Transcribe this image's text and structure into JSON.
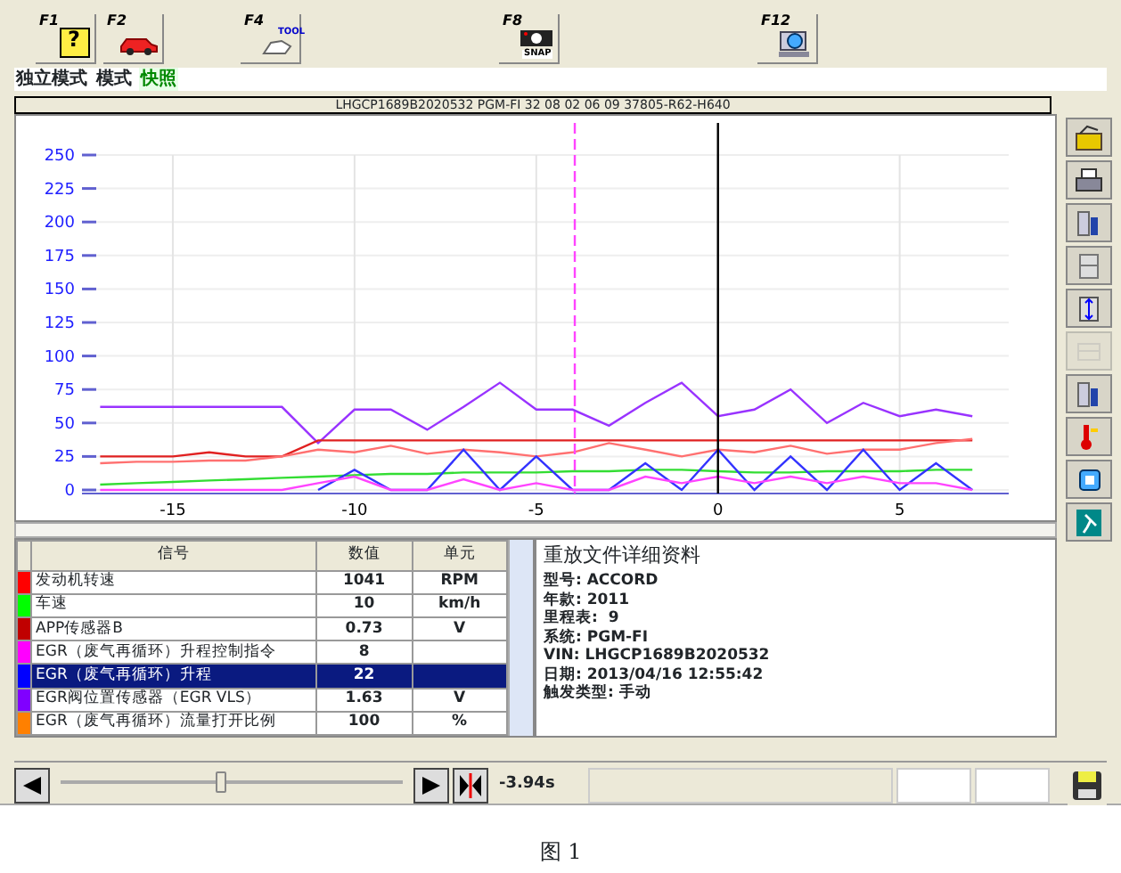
{
  "function_keys": [
    {
      "key": "F1",
      "icon_text": "?"
    },
    {
      "key": "F2"
    },
    {
      "key": "F4",
      "icon_text": "TOOL"
    },
    {
      "key": "F8",
      "icon_text": "SNAP"
    },
    {
      "key": "F12"
    }
  ],
  "mode_bar": [
    {
      "label": "独立模式",
      "selected": false
    },
    {
      "label": "模式",
      "selected": false
    },
    {
      "label": "快照",
      "selected": true
    }
  ],
  "chart_header": "LHGCP1689B2020532  PGM-FI  32 08 02 06 09  37805-R62-H640",
  "chart_data": {
    "type": "line",
    "x": [
      -17,
      -16,
      -15,
      -14,
      -13,
      -12,
      -11,
      -10,
      -9,
      -8,
      -7,
      -6,
      -5,
      -4,
      -3,
      -2,
      -1,
      0,
      1,
      2,
      3,
      4,
      5,
      6,
      7
    ],
    "series": [
      {
        "color": "#9933ff",
        "values": [
          62,
          62,
          62,
          62,
          62,
          62,
          35,
          60,
          60,
          45,
          62,
          80,
          60,
          60,
          48,
          65,
          80,
          55,
          60,
          75,
          50,
          65,
          55,
          60,
          55
        ]
      },
      {
        "color": "#e02020",
        "values": [
          25,
          25,
          25,
          28,
          25,
          25,
          37,
          37,
          37,
          37,
          37,
          37,
          37,
          37,
          37,
          37,
          37,
          37,
          37,
          37,
          37,
          37,
          37,
          37,
          37
        ]
      },
      {
        "color": "#ff7070",
        "values": [
          20,
          21,
          21,
          22,
          22,
          25,
          30,
          28,
          33,
          27,
          30,
          28,
          25,
          28,
          35,
          30,
          25,
          30,
          28,
          33,
          27,
          30,
          30,
          35,
          38
        ]
      },
      {
        "color": "#33dd33",
        "values": [
          4,
          5,
          6,
          7,
          8,
          9,
          10,
          11,
          12,
          12,
          13,
          13,
          13,
          14,
          14,
          15,
          15,
          14,
          13,
          13,
          14,
          14,
          14,
          15,
          15
        ]
      },
      {
        "color": "#3333ff",
        "values": [
          null,
          null,
          null,
          null,
          null,
          null,
          0,
          15,
          0,
          0,
          30,
          0,
          25,
          0,
          0,
          20,
          0,
          30,
          0,
          25,
          0,
          30,
          0,
          20,
          0
        ]
      },
      {
        "color": "#ff44ff",
        "values": [
          0,
          0,
          0,
          0,
          0,
          0,
          5,
          10,
          0,
          0,
          8,
          0,
          5,
          0,
          0,
          10,
          5,
          10,
          5,
          10,
          5,
          10,
          5,
          5,
          0
        ]
      }
    ],
    "xlim": [
      -17.5,
      8
    ],
    "ylim": [
      0,
      250
    ],
    "xticks": [
      -15,
      -10,
      -5,
      0,
      5
    ],
    "yticks": [
      0,
      25,
      50,
      75,
      100,
      125,
      150,
      175,
      200,
      225,
      250
    ],
    "grid": true,
    "ref_lines": [
      {
        "axis": "x",
        "value": -3.94
      },
      {
        "axis": "x",
        "value": 0
      }
    ]
  },
  "table": {
    "columns": [
      "信号",
      "数值",
      "单元"
    ],
    "rows": [
      {
        "color": "#ff0000",
        "signal": "发动机转速",
        "value": "1041",
        "unit": "RPM",
        "selected": false
      },
      {
        "color": "#00ff00",
        "signal": "车速",
        "value": "10",
        "unit": "km/h",
        "selected": false
      },
      {
        "color": "#c00000",
        "signal": "APP传感器B",
        "value": "0.73",
        "unit": "V",
        "selected": false
      },
      {
        "color": "#ff00ff",
        "signal": "EGR（废气再循环）升程控制指令",
        "value": "8",
        "unit": "",
        "selected": false
      },
      {
        "color": "#0000ff",
        "signal": "EGR（废气再循环）升程",
        "value": "22",
        "unit": "",
        "selected": true
      },
      {
        "color": "#8000ff",
        "signal": "EGR阀位置传感器（EGR VLS）",
        "value": "1.63",
        "unit": "V",
        "selected": false
      },
      {
        "color": "#ff8000",
        "signal": "EGR（废气再循环）流量打开比例",
        "value": "100",
        "unit": "%",
        "selected": false
      }
    ]
  },
  "details": {
    "title": "重放文件详细资料",
    "lines": [
      "型号: ACCORD",
      "年款: 2011",
      "里程表:  9",
      "系统: PGM-FI",
      "VIN: LHGCP1689B2020532",
      "日期: 2013/04/16 12:55:42",
      "触发类型: 手动"
    ]
  },
  "side_toolbar": [
    {
      "disabled": false
    },
    {
      "disabled": false
    },
    {
      "disabled": false
    },
    {
      "disabled": false
    },
    {
      "disabled": false
    },
    {
      "disabled": true
    },
    {
      "disabled": false
    },
    {
      "disabled": false
    },
    {
      "disabled": false
    },
    {
      "disabled": false
    }
  ],
  "playback": {
    "level": 0.47,
    "time": "-3.94s"
  },
  "caption": "图 1"
}
